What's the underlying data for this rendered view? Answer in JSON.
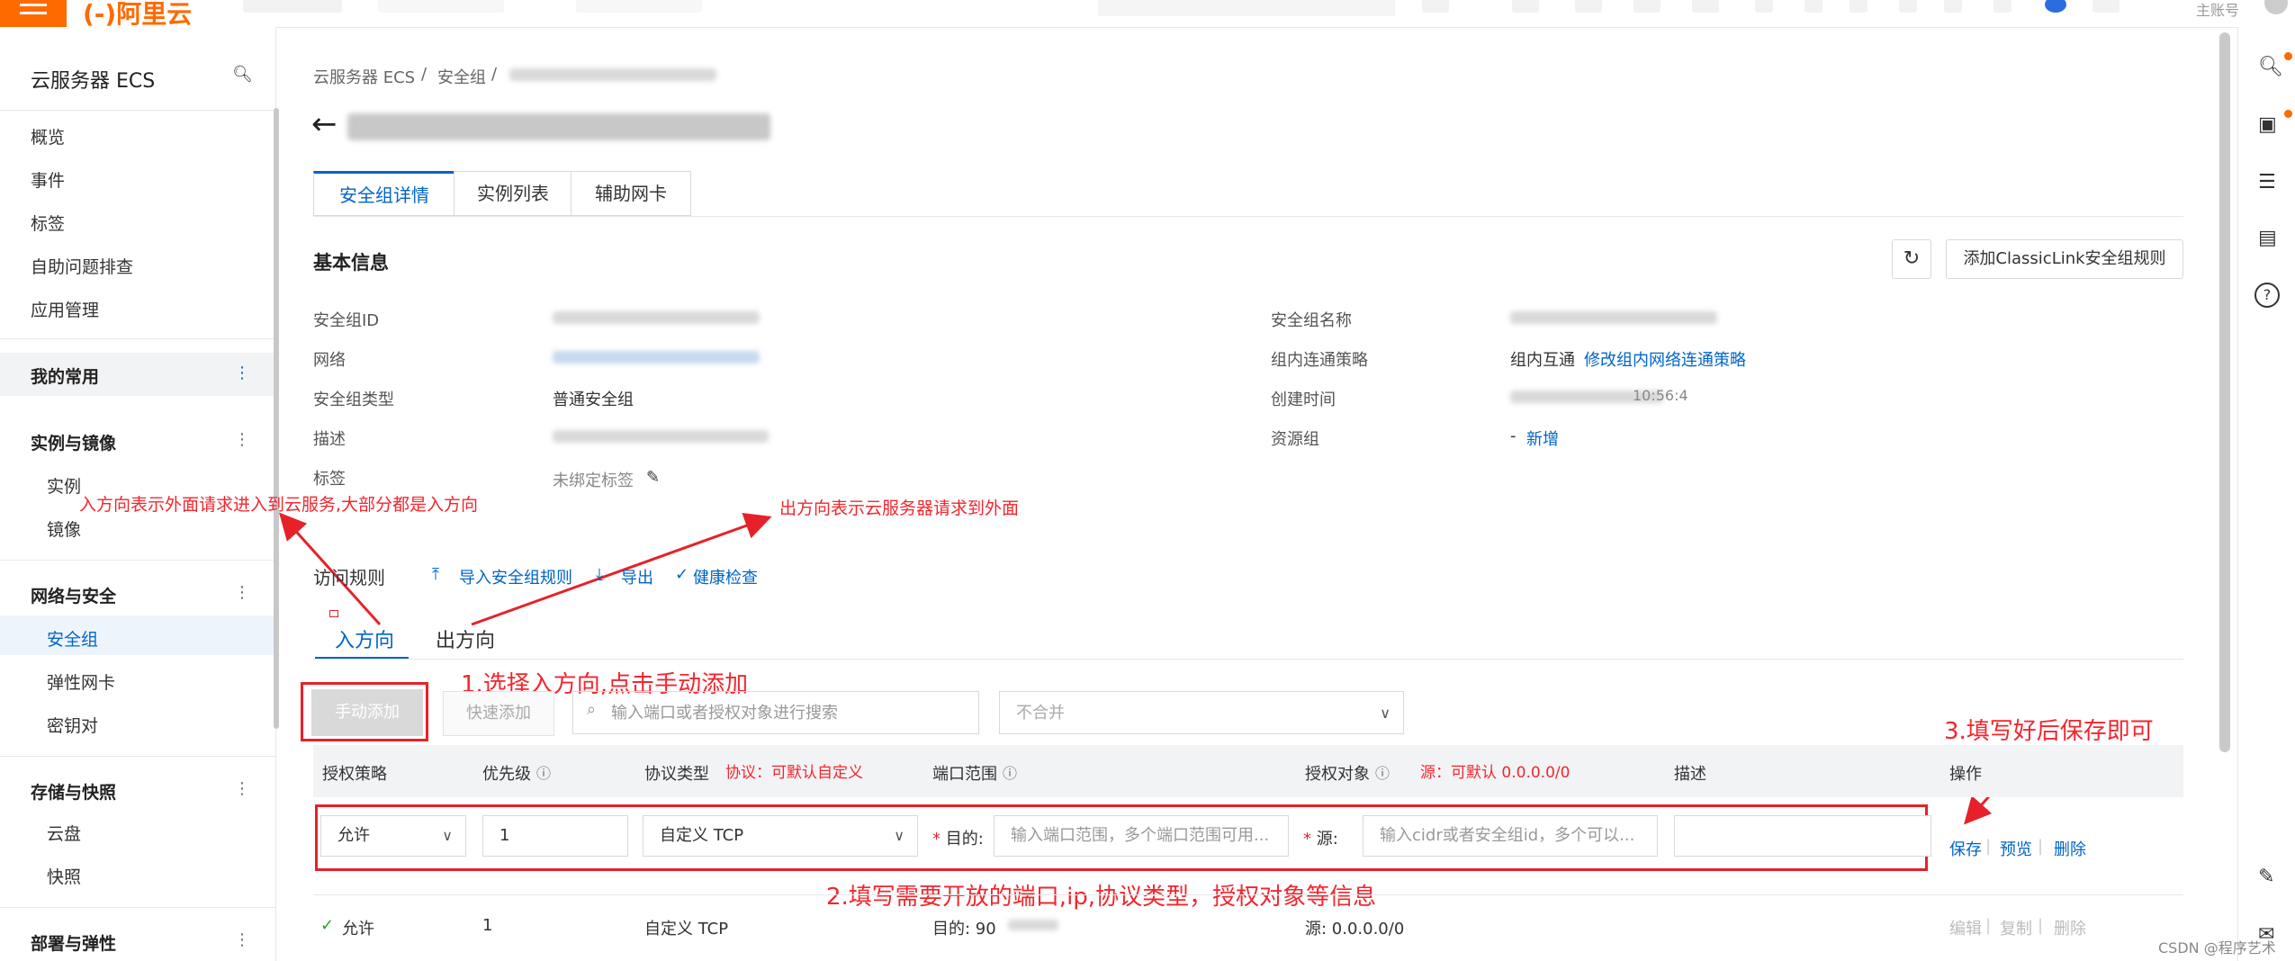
{
  "topbar": {
    "account": "主账号"
  },
  "sidebar": {
    "title": "云服务器 ECS",
    "items": [
      "概览",
      "事件",
      "标签",
      "自助问题排查",
      "应用管理"
    ],
    "favorites": "我的常用",
    "groups": [
      {
        "title": "实例与镜像",
        "items": [
          "实例",
          "镜像"
        ]
      },
      {
        "title": "网络与安全",
        "items": [
          "安全组",
          "弹性网卡",
          "密钥对"
        ]
      },
      {
        "title": "存储与快照",
        "items": [
          "云盘",
          "快照"
        ]
      },
      {
        "title": "部署与弹性",
        "items": []
      }
    ]
  },
  "breadcrumb": [
    "云服务器 ECS",
    "安全组"
  ],
  "tabs": [
    "安全组详情",
    "实例列表",
    "辅助网卡"
  ],
  "basic_info": {
    "title": "基本信息",
    "classic_button": "添加ClassicLink安全组规则",
    "labels": {
      "sg_id": "安全组ID",
      "network": "网络",
      "sg_type": "安全组类型",
      "desc": "描述",
      "tags": "标签",
      "sg_name": "安全组名称",
      "intra_policy": "组内连通策略",
      "created": "创建时间",
      "resource_group": "资源组"
    },
    "values": {
      "sg_type": "普通安全组",
      "tags": "未绑定标签",
      "intra_policy": "组内互通",
      "intra_policy_link": "修改组内网络连通策略",
      "created_tail": "10:56:4",
      "resource_group_dash": "-",
      "resource_group_link": "新增"
    }
  },
  "rules": {
    "title": "访问规则",
    "import": "导入安全组规则",
    "export": "导出",
    "health": "健康检查",
    "dir_in": "入方向",
    "dir_out": "出方向",
    "manual_add": "手动添加",
    "quick_add": "快速添加",
    "search_placeholder": "输入端口或者授权对象进行搜索",
    "merge": "不合并",
    "columns": [
      "授权策略",
      "优先级",
      "协议类型",
      "端口范围",
      "授权对象",
      "描述",
      "操作"
    ],
    "edit_row": {
      "policy": "允许",
      "priority": "1",
      "protocol": "自定义 TCP",
      "dest_label": "目的:",
      "port_placeholder": "输入端口范围，多个端口范围可用...",
      "src_label": "源:",
      "src_placeholder": "输入cidr或者安全组id，多个可以...",
      "save": "保存",
      "preview": "预览",
      "delete": "删除"
    },
    "data_row": {
      "policy": "允许",
      "priority": "1",
      "protocol": "自定义 TCP",
      "dest": "目的: 90",
      "source": "源: 0.0.0.0/0",
      "edit": "编辑",
      "copy": "复制",
      "delete": "删除"
    }
  },
  "annotations": {
    "in_note": "入方向表示外面请求进入到云服务,大部分都是入方向",
    "out_note": "出方向表示云服务器请求到外面",
    "step1": "1.选择入方向,点击手动添加",
    "step2": "2.填写需要开放的端口,ip,协议类型，授权对象等信息",
    "step3": "3.填写好后保存即可",
    "protocol_note": "协议：可默认自定义",
    "source_note": "源：可默认 0.0.0.0/0"
  },
  "watermark": "CSDN @程序艺术"
}
